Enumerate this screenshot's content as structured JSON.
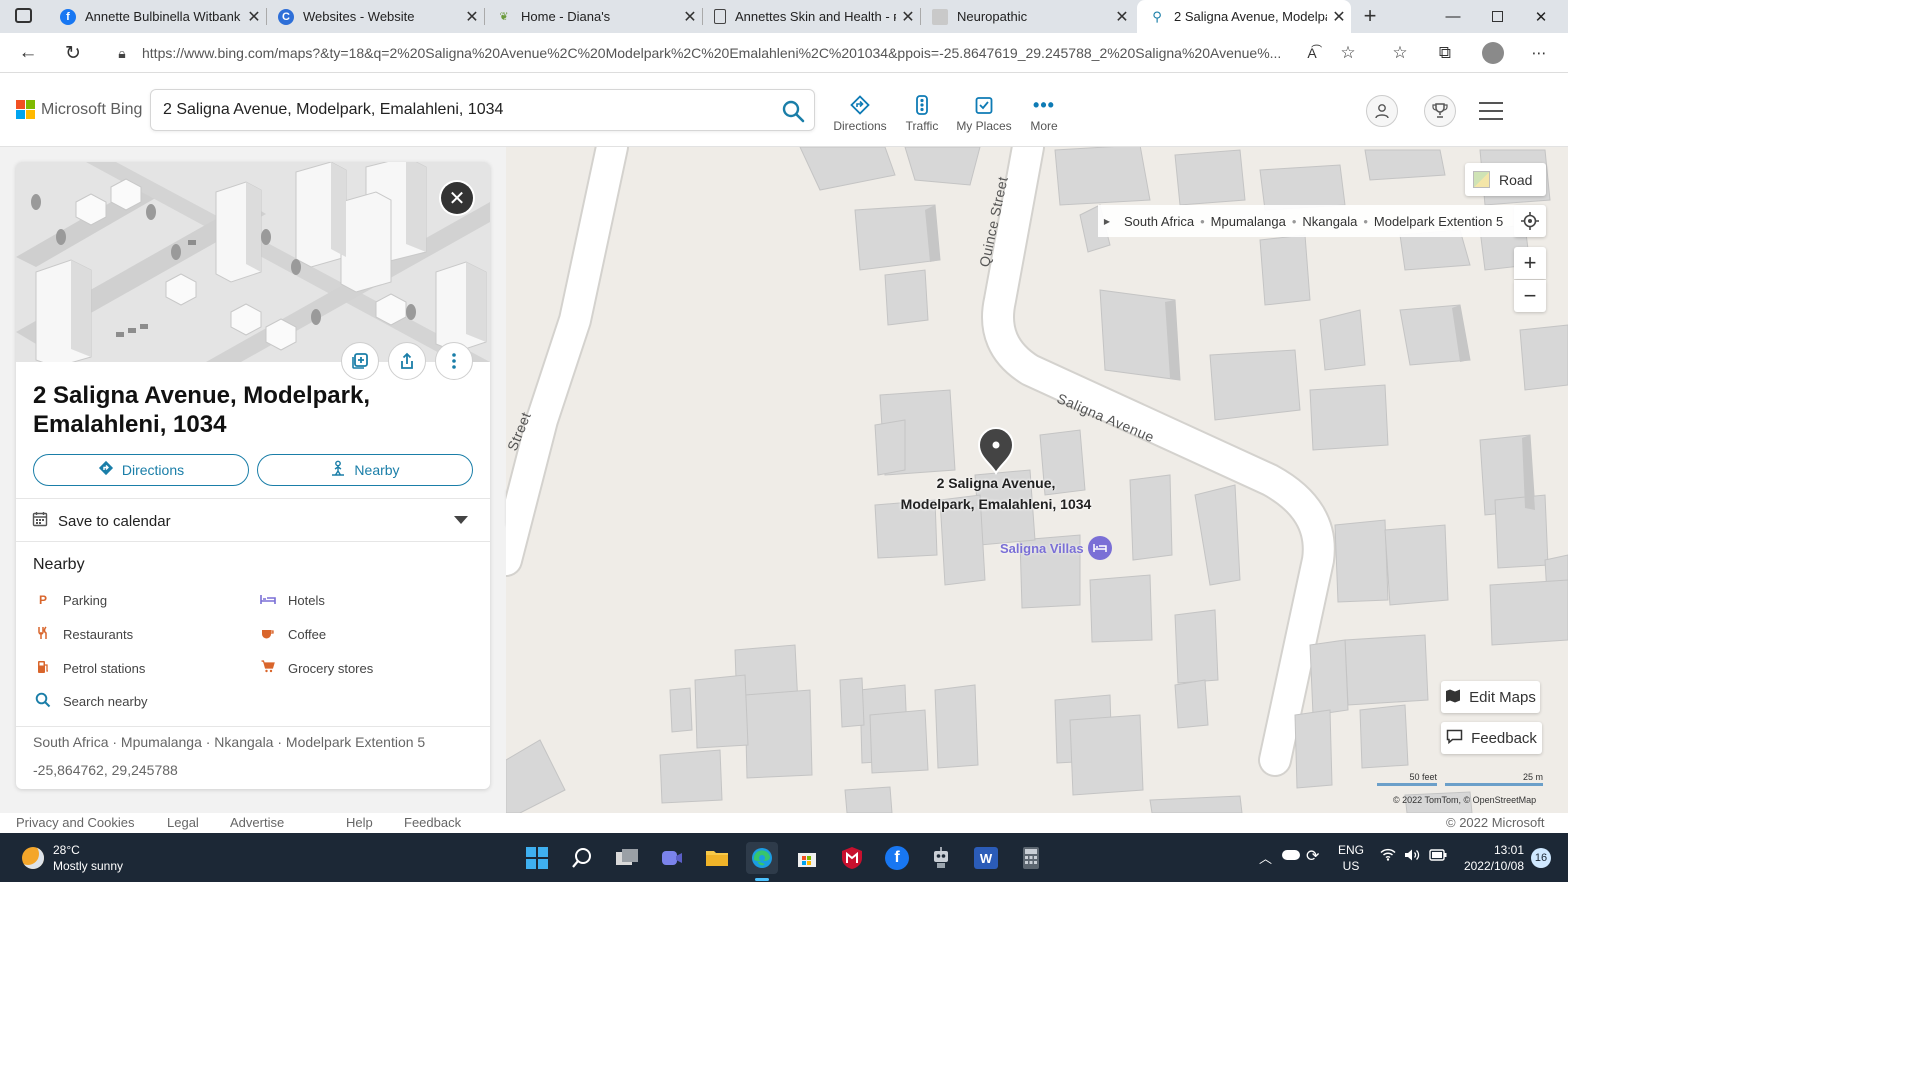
{
  "browser": {
    "tabs": [
      {
        "title": "Annette Bulbinella Witbank",
        "icon": "facebook-icon",
        "active": false
      },
      {
        "title": "Websites - Website",
        "icon": "website-icon",
        "active": false
      },
      {
        "title": "Home - Diana's",
        "icon": "leaf-icon",
        "active": false
      },
      {
        "title": "Annettes Skin and Health - ʀ",
        "icon": "document-icon",
        "active": false
      },
      {
        "title": "Neuropathic",
        "icon": "image-icon",
        "active": false
      },
      {
        "title": "2 Saligna Avenue, Modelpar",
        "icon": "search-icon",
        "active": true
      }
    ],
    "url": "https://www.bing.com/maps?&ty=18&q=2%20Saligna%20Avenue%2C%20Modelpark%2C%20Emalahleni%2C%201034&ppois=-25.8647619_29.245788_2%20Saligna%20Avenue%..."
  },
  "header": {
    "brand": "Microsoft Bing",
    "search_value": "2 Saligna Avenue, Modelpark, Emalahleni, 1034",
    "nav": [
      {
        "label": "Directions",
        "icon": "directions-icon"
      },
      {
        "label": "Traffic",
        "icon": "traffic-icon"
      },
      {
        "label": "My Places",
        "icon": "my-places-icon"
      },
      {
        "label": "More",
        "icon": "more-icon"
      }
    ]
  },
  "panel": {
    "title": "2 Saligna Avenue, Modelpark, Emalahleni, 1034",
    "directions_label": "Directions",
    "nearby_label": "Nearby",
    "save_calendar": "Save to calendar",
    "nearby_heading": "Nearby",
    "nearby_items": [
      {
        "label": "Parking",
        "icon": "parking-icon",
        "color": "#d9652b"
      },
      {
        "label": "Hotels",
        "icon": "hotel-icon",
        "color": "#7a6fd6"
      },
      {
        "label": "Restaurants",
        "icon": "restaurant-icon",
        "color": "#d9652b"
      },
      {
        "label": "Coffee",
        "icon": "coffee-icon",
        "color": "#d9652b"
      },
      {
        "label": "Petrol stations",
        "icon": "petrol-icon",
        "color": "#d9652b"
      },
      {
        "label": "Grocery stores",
        "icon": "grocery-icon",
        "color": "#d9652b"
      },
      {
        "label": "Search nearby",
        "icon": "search-icon",
        "color": "#1a7ea8"
      }
    ],
    "location_line": "South Africa · Mpumalanga · Nkangala · Modelpark Extention 5",
    "coordinates": "-25,864762, 29,245788"
  },
  "map": {
    "style_label": "Road",
    "breadcrumb": [
      "South Africa",
      "Mpumalanga",
      "Nkangala",
      "Modelpark Extention 5"
    ],
    "pin_label_line1": "2 Saligna Avenue,",
    "pin_label_line2": "Modelpark, Emalahleni, 1034",
    "poi_label": "Saligna Villas",
    "streets": [
      "Quince Street",
      "Saligna Avenue",
      "Street"
    ],
    "edit_maps": "Edit Maps",
    "feedback": "Feedback",
    "scale_feet": "50 feet",
    "scale_m": "25 m",
    "attribution": "© 2022 TomTom, © OpenStreetMap"
  },
  "footer": {
    "links": [
      "Privacy and Cookies",
      "Legal",
      "Advertise",
      "Help",
      "Feedback"
    ],
    "copyright": "© 2022 Microsoft"
  },
  "taskbar": {
    "weather_temp": "28°C",
    "weather_desc": "Mostly sunny",
    "lang_line1": "ENG",
    "lang_line2": "US",
    "time": "13:01",
    "date": "2022/10/08",
    "notifications": "16"
  },
  "colors": {
    "accent": "#1a7ea8",
    "poi": "#7a6fd6"
  }
}
